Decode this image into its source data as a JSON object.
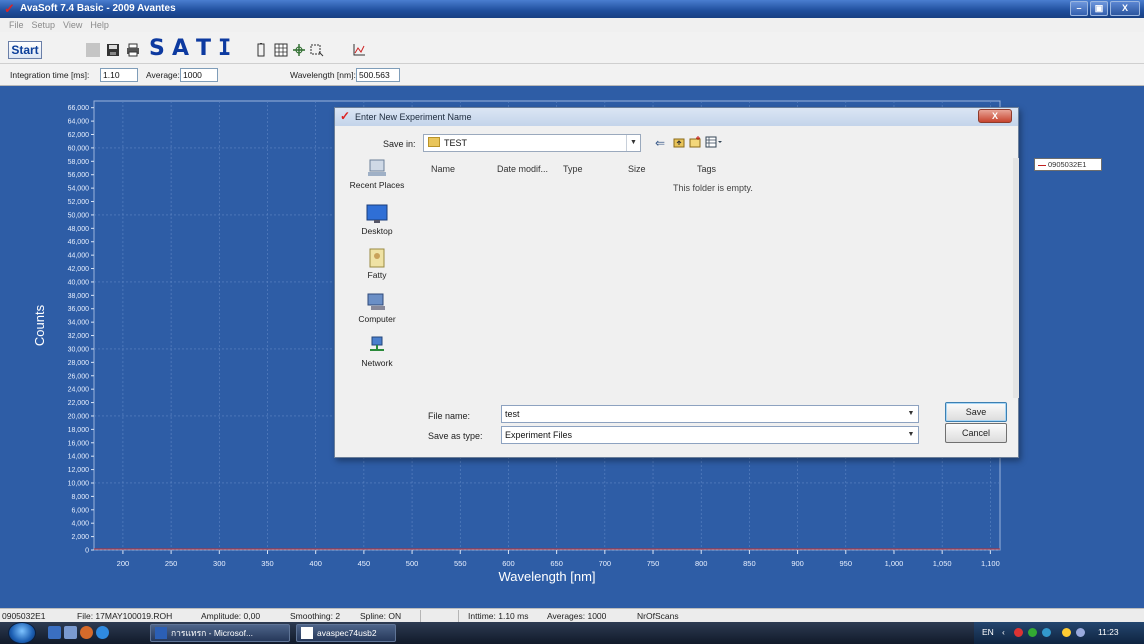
{
  "window": {
    "title": "AvaSoft 7.4 Basic - 2009 Avantes",
    "minimize": "–",
    "maximize": "▣",
    "close": "X"
  },
  "menu": [
    "File",
    "Setup",
    "View",
    "Help"
  ],
  "toolbar": {
    "start_label": "Start",
    "letters": [
      "S",
      "A",
      "T",
      "I"
    ]
  },
  "params": {
    "integration_label": "Integration time [ms]:",
    "integration_value": "1.10",
    "average_label": "Average:",
    "average_value": "1000",
    "wavelength_label": "Wavelength [nm]:",
    "wavelength_value": "500.563"
  },
  "chart_data": {
    "type": "line",
    "xlabel": "Wavelength [nm]",
    "ylabel": "Counts",
    "xlim": [
      170,
      1110
    ],
    "ylim": [
      0,
      67000
    ],
    "xticks": [
      200,
      250,
      300,
      350,
      400,
      450,
      500,
      550,
      600,
      650,
      700,
      750,
      800,
      850,
      900,
      950,
      1000,
      1050,
      1100
    ],
    "yticks": [
      0,
      2000,
      4000,
      6000,
      8000,
      10000,
      12000,
      14000,
      16000,
      18000,
      20000,
      22000,
      24000,
      26000,
      28000,
      30000,
      32000,
      34000,
      36000,
      38000,
      40000,
      42000,
      44000,
      46000,
      48000,
      50000,
      52000,
      54000,
      56000,
      58000,
      60000,
      62000,
      64000,
      66000
    ],
    "grid": true,
    "legend": [
      "0905032E1"
    ],
    "series": [
      {
        "name": "0905032E1",
        "x": [],
        "y": []
      }
    ]
  },
  "dialog": {
    "title": "Enter New Experiment Name",
    "close": "X",
    "save_in_label": "Save in:",
    "save_in_value": "TEST",
    "columns": [
      "Name",
      "Date modif...",
      "Type",
      "Size",
      "Tags"
    ],
    "empty_message": "This folder is empty.",
    "places": [
      "Recent Places",
      "Desktop",
      "Fatty",
      "Computer",
      "Network"
    ],
    "file_name_label": "File name:",
    "file_name_value": "test",
    "save_type_label": "Save as type:",
    "save_type_value": "Experiment Files",
    "save_button": "Save",
    "cancel_button": "Cancel"
  },
  "status": {
    "detector": "0905032E1",
    "file": "File: 17MAY100019.ROH",
    "amplitude": "Amplitude: 0,00",
    "smoothing": "Smoothing: 2",
    "spline": "Spline: ON",
    "inttime": "Inttime: 1.10 ms",
    "averages": "Averages: 1000",
    "scans": "NrOfScans"
  },
  "taskbar": {
    "items": [
      "การแทรก - Microsof...",
      "avaspec74usb2"
    ],
    "language": "EN",
    "clock": "11:23"
  }
}
